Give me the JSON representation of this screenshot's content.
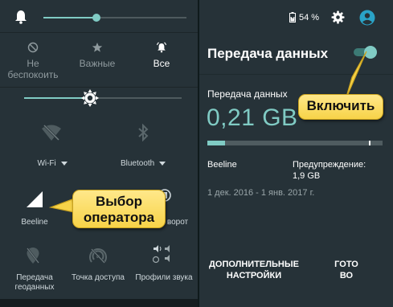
{
  "left": {
    "notifications_modes": {
      "do_not_disturb": "Не беспокоить",
      "important": "Важные",
      "all": "Все"
    },
    "tiles": {
      "wifi": "Wi-Fi",
      "bluetooth": "Bluetooth",
      "carrier": "Beeline",
      "rotation_partial": "ворот",
      "location": "Передача геоданных",
      "hotspot": "Точка доступа",
      "sound_profiles": "Профили звука"
    },
    "volume_level": 0.5,
    "brightness_level": 0.5
  },
  "right": {
    "status": {
      "battery": "54 %"
    },
    "title": "Передача данных",
    "toggle_on": true,
    "usage_label": "Передача данных",
    "usage_amount": "0,21 GB",
    "usage_fraction": 0.1,
    "warning_fraction": 0.92,
    "carrier": "Beeline",
    "warning_label": "Предупреждение:",
    "warning_value": "1,9 GB",
    "period": "1 дек. 2016 - 1 янв. 2017 г.",
    "more_settings": "ДОПОЛНИТЕЛЬНЫЕ НАСТРОЙКИ",
    "done": "ГОТОВО"
  },
  "callouts": {
    "carrier_select": "Выбор оператора",
    "enable": "Включить"
  },
  "colors": {
    "panel_bg": "#263238",
    "accent": "#80cbc4",
    "callout_bg": "#f7d348"
  }
}
